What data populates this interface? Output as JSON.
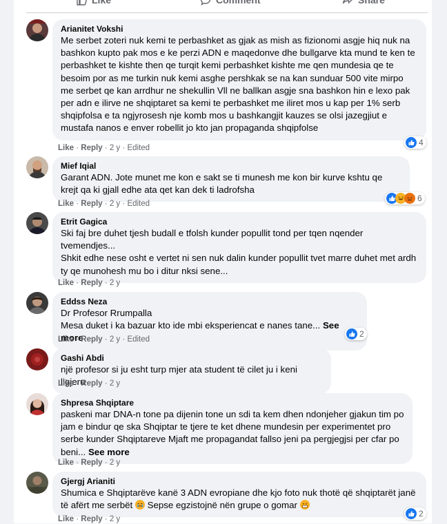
{
  "action_bar": {
    "like": "Like",
    "comment": "Comment",
    "share": "Share"
  },
  "meta_labels": {
    "like": "Like",
    "reply": "Reply",
    "sep": "·"
  },
  "comments": [
    {
      "author": "Arianitet Vokshi",
      "text": "Me serbet zoteri nuk kemi te perbashket as gjak as mish as fizionomi asgje hiq nuk na bashkon kupto pak mos e ke perzi ADN e maqedonve dhe bullgarve kta mund te ken te perbashket te kishte then qe turqit kemi perbashket kishte me qen mundesia qe te besoim por as me turkin nuk kemi asghe pershkak se na kan sunduar 500 vite mirpo me serbet qe kan arrdhur ne shekullin Vll ne ballkan asgje sna bashkon hin e lexo pak per adn e ilirve ne shqiptaret sa kemi te perbashket me iliret mos u kap per 1% serb shqipfolsa e ta ngjyrosesh nje komb mos u bashkangjit kauzes se olsi jazegjiut e mustafa nanos e enver robellit jo kto jan propaganda shqipfolse",
      "time": "2 y",
      "edited": "Edited",
      "reactions": "4"
    },
    {
      "author": "Mief Iqial",
      "text": "Garant ADN. Jote munet me kon e sakt se ti munesh me kon bir kurve kshtu qe krejt qa ki gjall edhe ata qet kan dek ti ladrofsha",
      "time": "2 y",
      "edited": "Edited",
      "reactions": "6"
    },
    {
      "author": "Etrit Gagica",
      "text1": "Ski faj bre duhet tjesh budall e tfolsh kunder popullit tond per tqen nqender tvemendjes...",
      "text2": "Shkit edhe nese osht e vertet ni sen nuk dalin kunder popullit tvet marre duhet met ardh ty qe munohesh mu bo i ditur nksi sene...",
      "time": "2 y"
    },
    {
      "author": "Eddss Neza",
      "text1": "Dr Profesor Rrumpalla",
      "text2": "Mesa duket i ka bazuar kto ide mbi eksperiencat e nanes tane...",
      "see_more": "See more",
      "time": "2 y",
      "edited": "Edited",
      "reactions": "2"
    },
    {
      "author": "Gashi Abdi",
      "text": "një profesor si ju esht turp mjer ata student të cilet ju i keni ligjeru",
      "time": "2 y"
    },
    {
      "author": "Shpresa Shqiptare",
      "text": "paskeni mar DNA-n tone pa dijenin tone un sdi ta kem dhen ndonjeher gjakun tim po jam e bindur qe ska Shqiptar te tjere te ket dhene mundesin per experimentet pro serbe kunder Shqiptareve Mjaft me propagandat fallso jeni pa pergjegjsi per cfar po beni...",
      "see_more": "See more",
      "time": "2 y"
    },
    {
      "author": "Gjergj Arianiti",
      "text": "Shumica e Shqiptarëve kanë 3 ADN evropiane dhe kjo foto nuk thotë që shqiptarët janë të afërt me serbët",
      "text_b": "Sepse egzistojnë nën grupe o gomar",
      "time": "2 y",
      "reactions": "2"
    }
  ]
}
